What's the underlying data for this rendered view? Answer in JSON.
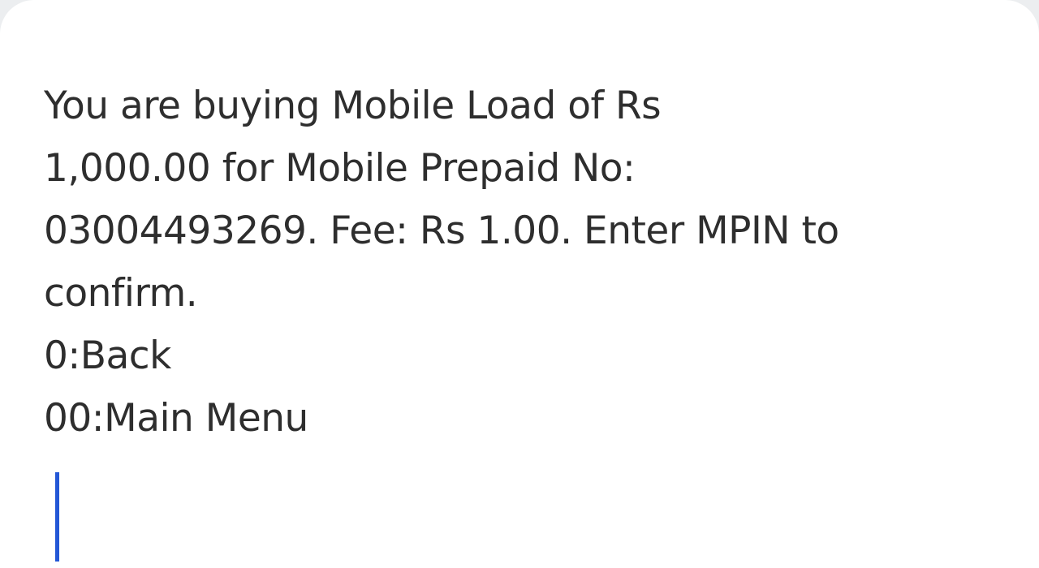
{
  "dialog": {
    "message_lines": [
      "You are buying Mobile Load of Rs",
      "1,000.00 for Mobile Prepaid No:",
      "03004493269. Fee: Rs 1.00. Enter MPIN to",
      "confirm."
    ],
    "options": [
      "0:Back",
      "00:Main Menu"
    ],
    "input": {
      "value": "",
      "placeholder": ""
    },
    "colors": {
      "background": "#ffffff",
      "text": "#2e2e2e",
      "caret": "#2357d6"
    }
  }
}
